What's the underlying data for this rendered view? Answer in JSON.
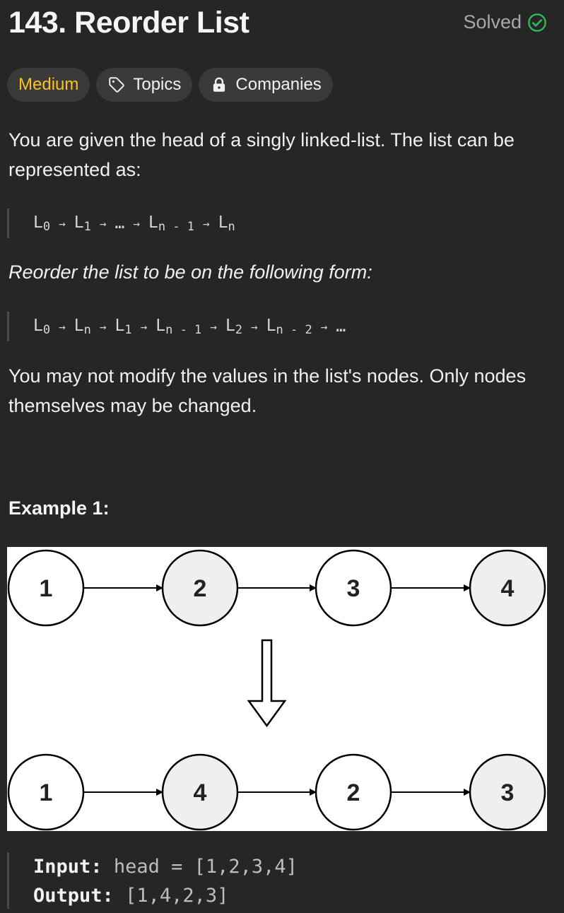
{
  "header": {
    "title": "143. Reorder List",
    "status": "Solved",
    "status_color": "#2cbb5d"
  },
  "tags": {
    "difficulty": "Medium",
    "topics": "Topics",
    "companies": "Companies"
  },
  "description": {
    "p1": "You are given the head of a singly linked-list. The list can be represented as:",
    "formula1": [
      {
        "base": "L",
        "sub": "0"
      },
      {
        "base": "L",
        "sub": "1"
      },
      {
        "base": "…",
        "sub": ""
      },
      {
        "base": "L",
        "sub": "n - 1"
      },
      {
        "base": "L",
        "sub": "n"
      }
    ],
    "p2": "Reorder the list to be on the following form:",
    "formula2": [
      {
        "base": "L",
        "sub": "0"
      },
      {
        "base": "L",
        "sub": "n"
      },
      {
        "base": "L",
        "sub": "1"
      },
      {
        "base": "L",
        "sub": "n - 1"
      },
      {
        "base": "L",
        "sub": "2"
      },
      {
        "base": "L",
        "sub": "n - 2"
      },
      {
        "base": "…",
        "sub": ""
      }
    ],
    "p3": "You may not modify the values in the list's nodes. Only nodes themselves may be changed."
  },
  "example": {
    "title": "Example 1:",
    "before": [
      "1",
      "2",
      "3",
      "4"
    ],
    "after": [
      "1",
      "4",
      "2",
      "3"
    ],
    "input_label": "Input:",
    "input_value": "head = [1,2,3,4]",
    "output_label": "Output:",
    "output_value": "[1,4,2,3]"
  }
}
